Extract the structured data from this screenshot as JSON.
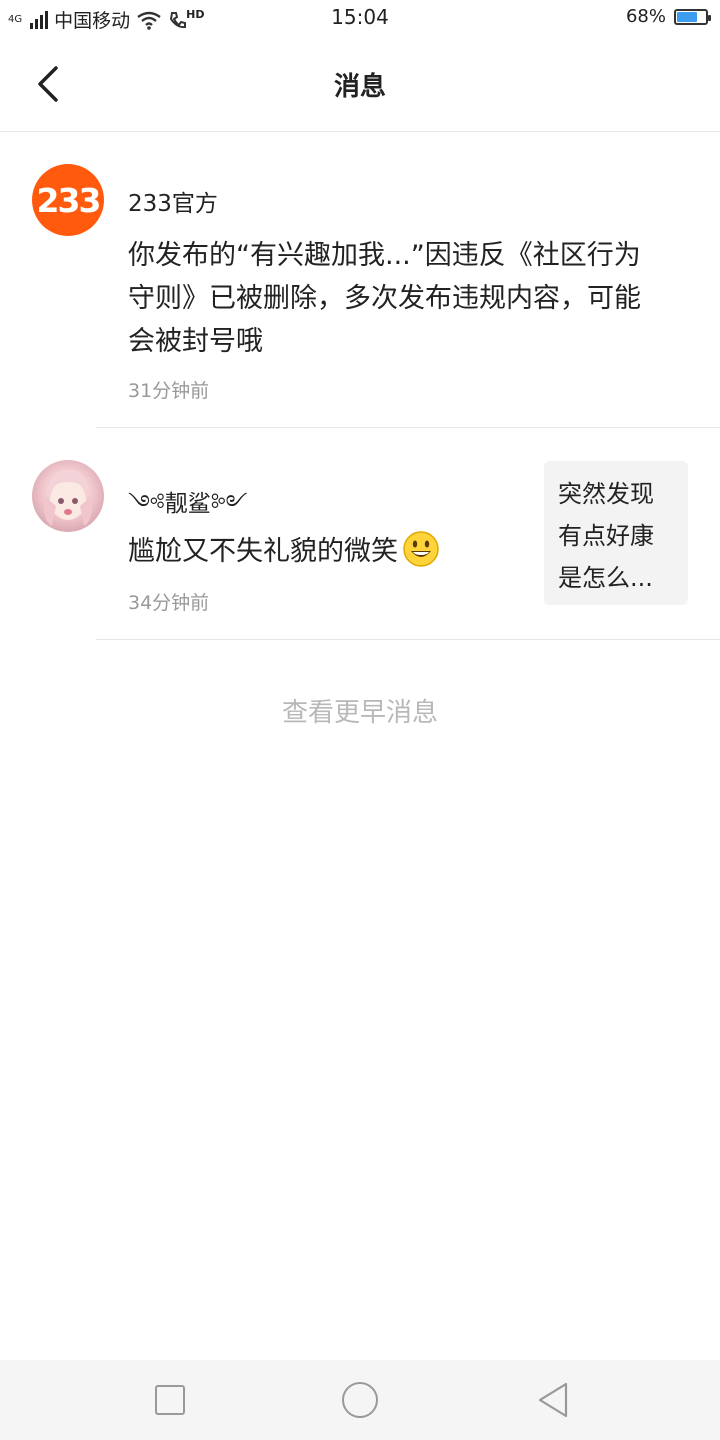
{
  "status_bar": {
    "network_type": "4G",
    "carrier": "中国移动",
    "hd_label": "HD",
    "time": "15:04",
    "battery_percent_text": "68%",
    "battery_level": 0.68
  },
  "header": {
    "title": "消息"
  },
  "messages": [
    {
      "avatar_text": "233",
      "sender": "233官方",
      "content": "你发布的“有兴趣加我...”因违反《社区行为守则》已被删除，多次发布违规内容，可能会被封号哦",
      "time": "31分钟前"
    },
    {
      "sender": "༺靓鲨༻",
      "content": "尴尬又不失礼貌的微笑",
      "emoji": "smiley-emoji",
      "time": "34分钟前",
      "quoted_text": "突然发现有点好康是怎么..."
    }
  ],
  "load_more_label": "查看更早消息",
  "colors": {
    "accent_233": "#ff5a0d",
    "battery": "#3c9cf0",
    "secondary_text": "#999999"
  }
}
